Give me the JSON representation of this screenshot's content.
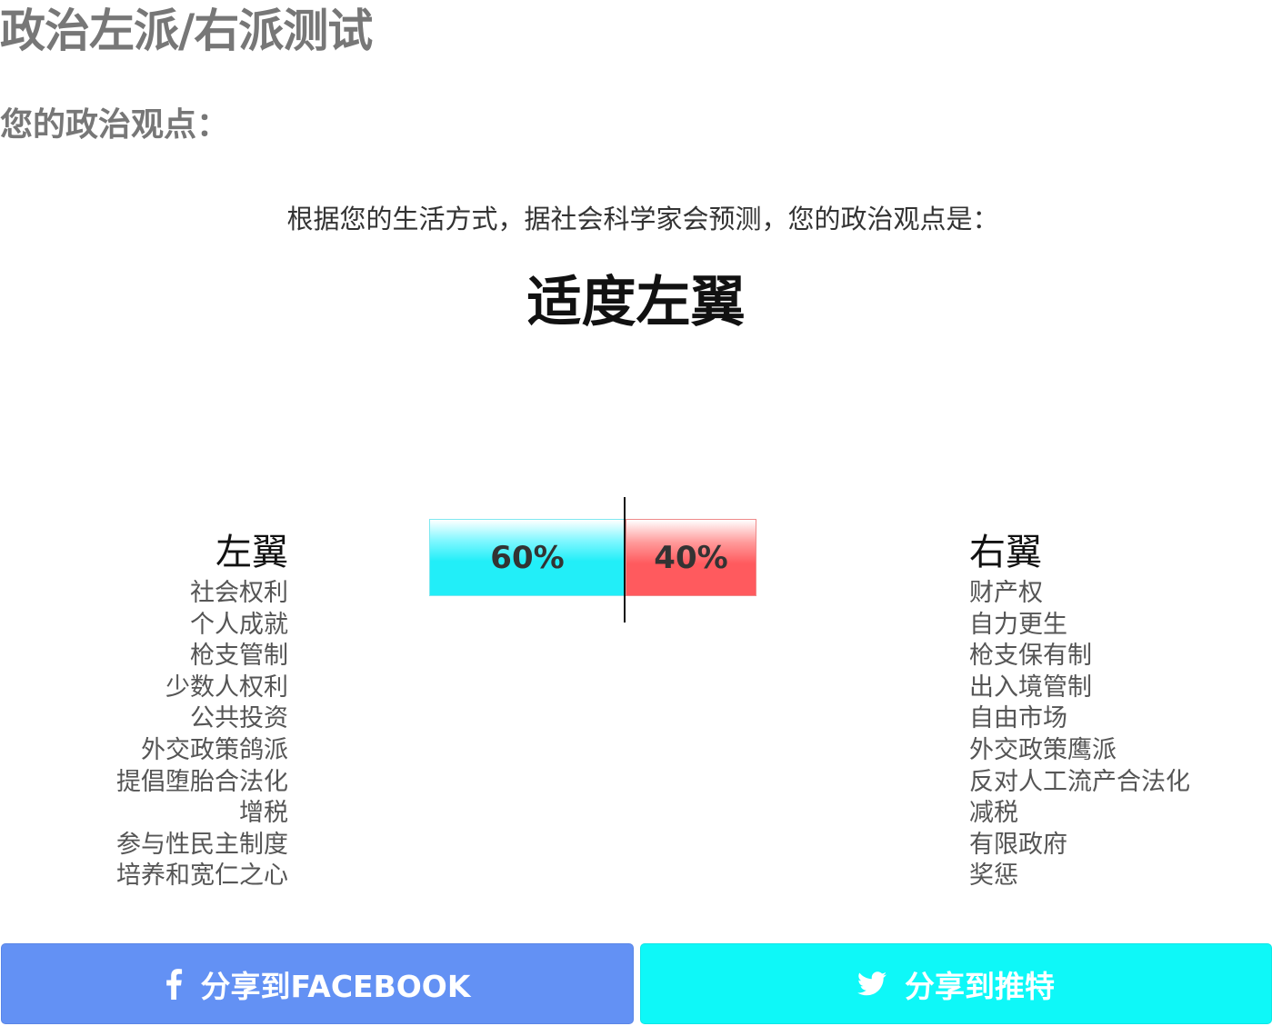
{
  "page": {
    "title": "政治左派/右派测试",
    "subtitle": "您的政治观点："
  },
  "result": {
    "intro": "根据您的生活方式，据社会科学家会预测，您的政治观点是：",
    "label": "适度左翼"
  },
  "scale": {
    "left_value": 60,
    "right_value": 40,
    "left_label": "60%",
    "right_label": "40%",
    "left_color": "#22eef8",
    "right_color": "#ff5a5e"
  },
  "left_column": {
    "heading": "左翼",
    "items": [
      "社会权利",
      "个人成就",
      "枪支管制",
      "少数人权利",
      "公共投资",
      "外交政策鸽派",
      "提倡堕胎合法化",
      "增税",
      "参与性民主制度",
      "培养和宽仁之心"
    ]
  },
  "right_column": {
    "heading": "右翼",
    "items": [
      "财产权",
      "自力更生",
      "枪支保有制",
      "出入境管制",
      "自由市场",
      "外交政策鹰派",
      "反对人工流产合法化",
      "减税",
      "有限政府",
      "奖惩"
    ]
  },
  "share": {
    "facebook_label": "分享到FACEBOOK",
    "facebook_icon": "facebook-icon",
    "facebook_color": "#6391f4",
    "twitter_label": "分享到推特",
    "twitter_icon": "twitter-icon",
    "twitter_color": "#0ef8f8"
  }
}
